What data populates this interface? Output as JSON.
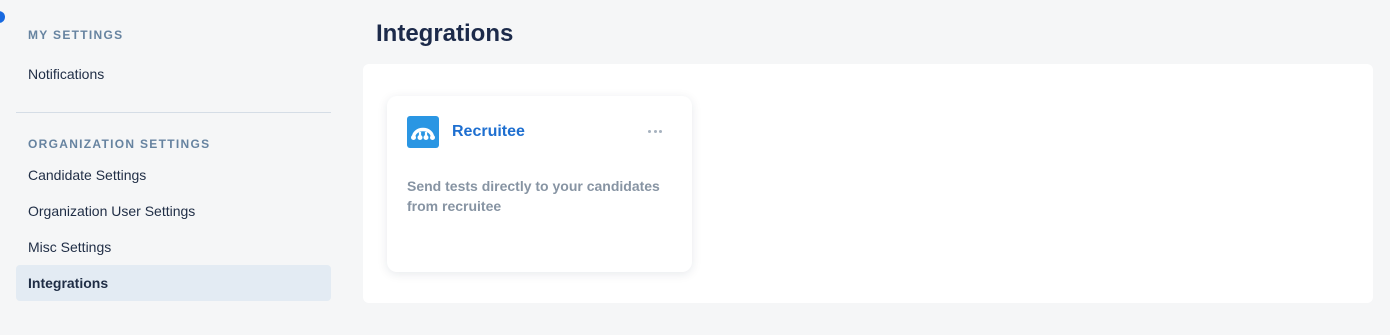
{
  "sidebar": {
    "my_settings_title": "MY SETTINGS",
    "my_items": [
      {
        "label": "Notifications"
      }
    ],
    "org_settings_title": "ORGANIZATION SETTINGS",
    "org_items": [
      {
        "label": "Candidate Settings"
      },
      {
        "label": "Organization User Settings"
      },
      {
        "label": "Misc Settings"
      },
      {
        "label": "Integrations",
        "active": true
      }
    ]
  },
  "main": {
    "title": "Integrations",
    "integrations": [
      {
        "name": "Recruitee",
        "icon": "recruitee-logo-icon",
        "description": "Send tests directly to your candidates from recruitee"
      }
    ]
  },
  "colors": {
    "accent": "#1e6fd0",
    "logo_bg": "#2a96e3",
    "active_item_bg": "#e3ebf3",
    "page_bg": "#f5f6f7"
  }
}
